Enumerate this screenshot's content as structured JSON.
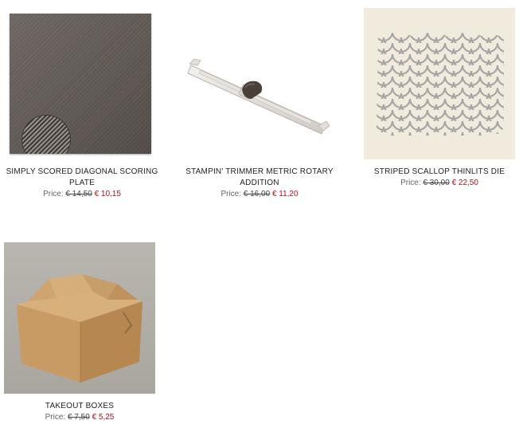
{
  "products": [
    {
      "title": "SIMPLY SCORED DIAGONAL SCORING PLATE",
      "price_label": "Price:",
      "old_price": "€ 14,50",
      "new_price": "€ 10,15",
      "image_icon": "scoring-plate-image"
    },
    {
      "title": "STAMPIN' TRIMMER METRIC ROTARY ADDITION",
      "price_label": "Price:",
      "old_price": "€ 16,00",
      "new_price": "€ 11,20",
      "image_icon": "trimmer-image"
    },
    {
      "title": "STRIPED SCALLOP THINLITS DIE",
      "price_label": "Price:",
      "old_price": "€ 30,00",
      "new_price": "€ 22,50",
      "image_icon": "scallop-die-image"
    },
    {
      "title": "TAKEOUT BOXES",
      "price_label": "Price:",
      "old_price": "€ 7,50",
      "new_price": "€ 5,25",
      "image_icon": "takeout-box-image"
    }
  ],
  "colors": {
    "sale_price": "#b5121b",
    "text": "#222222"
  }
}
